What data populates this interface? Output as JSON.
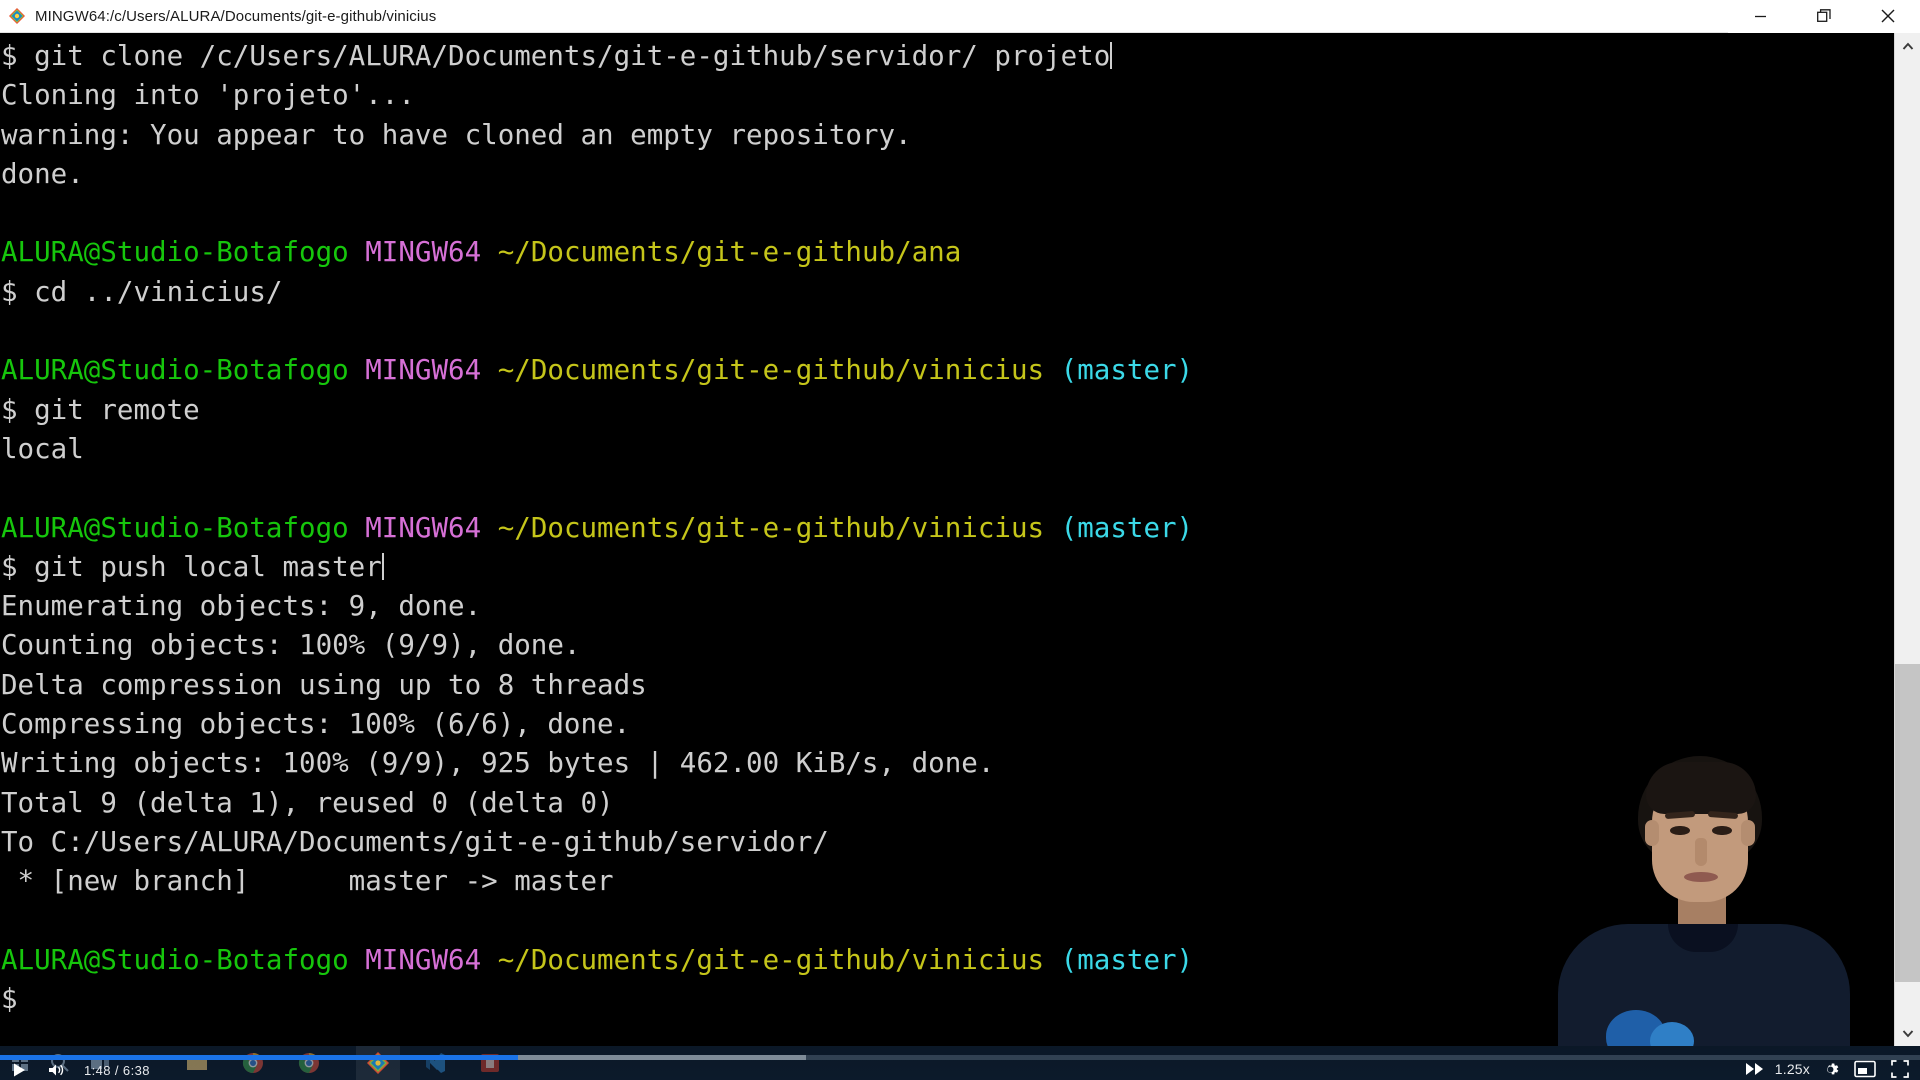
{
  "window": {
    "title": "MINGW64:/c/Users/ALURA/Documents/git-e-github/vinicius",
    "icon": "git-bash-icon",
    "minimize_label": "Minimize",
    "restore_label": "Restore",
    "close_label": "Close"
  },
  "terminal": {
    "background": "#000000",
    "colors": {
      "text": "#cccccc",
      "user_host": "#16c60c",
      "shell": "#d670d6",
      "path": "#c5c51a",
      "branch": "#3bd9e8"
    },
    "lines": [
      {
        "type": "command",
        "prompt": "$ ",
        "text": "git clone /c/Users/ALURA/Documents/git-e-github/servidor/ projeto",
        "cursor": true
      },
      {
        "type": "output",
        "text": "Cloning into 'projeto'..."
      },
      {
        "type": "output",
        "text": "warning: You appear to have cloned an empty repository."
      },
      {
        "type": "output",
        "text": "done."
      },
      {
        "type": "blank",
        "text": ""
      },
      {
        "type": "prompt",
        "user_host": "ALURA@Studio-Botafogo",
        "shell": "MINGW64",
        "path": "~/Documents/git-e-github/ana",
        "branch": ""
      },
      {
        "type": "command",
        "prompt": "$ ",
        "text": "cd ../vinicius/",
        "cursor": false
      },
      {
        "type": "blank",
        "text": ""
      },
      {
        "type": "prompt",
        "user_host": "ALURA@Studio-Botafogo",
        "shell": "MINGW64",
        "path": "~/Documents/git-e-github/vinicius",
        "branch": "(master)"
      },
      {
        "type": "command",
        "prompt": "$ ",
        "text": "git remote",
        "cursor": false
      },
      {
        "type": "output",
        "text": "local"
      },
      {
        "type": "blank",
        "text": ""
      },
      {
        "type": "prompt",
        "user_host": "ALURA@Studio-Botafogo",
        "shell": "MINGW64",
        "path": "~/Documents/git-e-github/vinicius",
        "branch": "(master)"
      },
      {
        "type": "command",
        "prompt": "$ ",
        "text": "git push local master",
        "cursor": true
      },
      {
        "type": "output",
        "text": "Enumerating objects: 9, done."
      },
      {
        "type": "output",
        "text": "Counting objects: 100% (9/9), done."
      },
      {
        "type": "output",
        "text": "Delta compression using up to 8 threads"
      },
      {
        "type": "output",
        "text": "Compressing objects: 100% (6/6), done."
      },
      {
        "type": "output",
        "text": "Writing objects: 100% (9/9), 925 bytes | 462.00 KiB/s, done."
      },
      {
        "type": "output",
        "text": "Total 9 (delta 1), reused 0 (delta 0)"
      },
      {
        "type": "output",
        "text": "To C:/Users/ALURA/Documents/git-e-github/servidor/"
      },
      {
        "type": "output",
        "text": " * [new branch]      master -> master"
      },
      {
        "type": "blank",
        "text": ""
      },
      {
        "type": "prompt",
        "user_host": "ALURA@Studio-Botafogo",
        "shell": "MINGW64",
        "path": "~/Documents/git-e-github/vinicius",
        "branch": "(master)"
      },
      {
        "type": "command",
        "prompt": "$ ",
        "text": "",
        "cursor": false
      }
    ]
  },
  "scrollbar": {
    "up_arrow": "chevron-up-icon",
    "down_arrow": "chevron-down-icon",
    "thumb_top_pct": 63,
    "thumb_height_pct": 33
  },
  "player": {
    "play_label": "play-icon",
    "volume_label": "volume-icon",
    "current_time": "1:48",
    "separator": " / ",
    "duration": "6:38",
    "timecode": "1:48 / 6:38",
    "speed": "1.25x",
    "next_label": "next-icon",
    "settings_label": "gear-icon",
    "pip_label": "picture-in-picture-icon",
    "fullscreen_label": "fullscreen-icon",
    "progress_played_pct": 27,
    "progress_buffered_pct": 42,
    "accent_color": "#1a73e8"
  },
  "taskbar": {
    "items": [
      {
        "name": "start-button"
      },
      {
        "name": "search-button"
      },
      {
        "name": "task-view-button"
      },
      {
        "name": "file-explorer-icon"
      },
      {
        "name": "chrome-icon"
      },
      {
        "name": "chrome-icon-2"
      },
      {
        "name": "git-bash-icon"
      },
      {
        "name": "vs-code-icon"
      },
      {
        "name": "app-icon-red"
      }
    ]
  },
  "webcam": {
    "label": "instructor-webcam-overlay"
  }
}
